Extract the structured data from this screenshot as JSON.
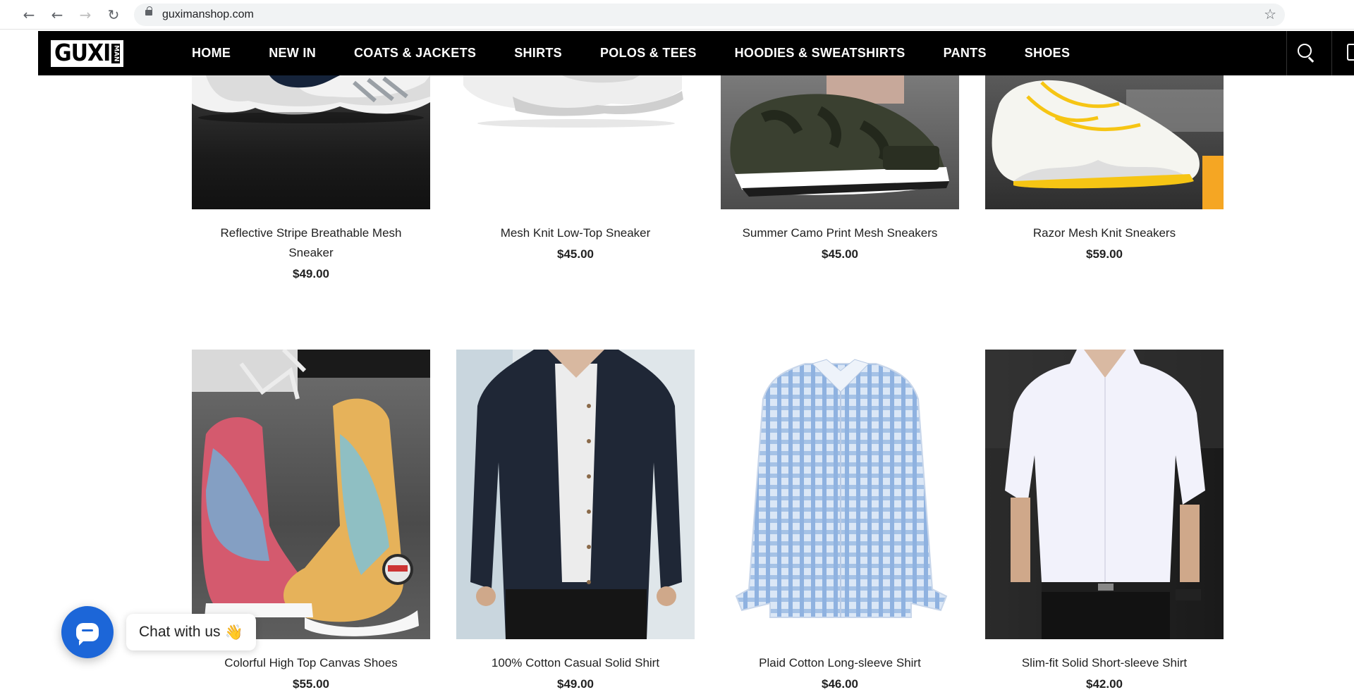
{
  "browser": {
    "url": "guximanshop.com"
  },
  "header": {
    "logo_main": "GUXI",
    "logo_side": "MAN",
    "menu": [
      "HOME",
      "NEW IN",
      "COATS & JACKETS",
      "SHIRTS",
      "POLOS & TEES",
      "HOODIES & SWEATSHIRTS",
      "PANTS",
      "SHOES"
    ]
  },
  "products": [
    {
      "name": "Reflective Stripe Breathable Mesh Sneaker",
      "price": "$49.00"
    },
    {
      "name": "Mesh Knit Low-Top Sneaker",
      "price": "$45.00"
    },
    {
      "name": "Summer Camo Print Mesh Sneakers",
      "price": "$45.00"
    },
    {
      "name": "Razor Mesh Knit Sneakers",
      "price": "$59.00"
    },
    {
      "name": "Colorful High Top Canvas Shoes",
      "price": "$55.00"
    },
    {
      "name": "100% Cotton Casual Solid Shirt",
      "price": "$49.00"
    },
    {
      "name": "Plaid Cotton Long-sleeve Shirt",
      "price": "$46.00"
    },
    {
      "name": "Slim-fit Solid Short-sleeve Shirt",
      "price": "$42.00"
    }
  ],
  "chat": {
    "label": "Chat with us",
    "emoji": "👋"
  },
  "colors": {
    "header_bg": "#000000",
    "chat_accent": "#1c66d8"
  }
}
